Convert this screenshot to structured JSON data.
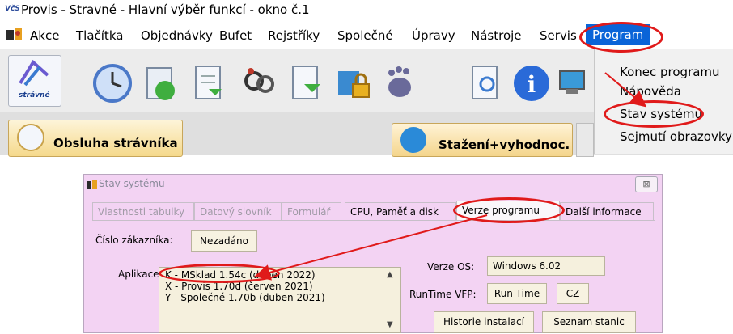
{
  "window": {
    "icon_text": "VčS",
    "title": "Provis - Stravné - Hlavní výběr funkcí - okno č.1"
  },
  "menubar": {
    "items": [
      "Akce",
      "Tlačítka",
      "Objednávky",
      "Bufet",
      "Rejstříky",
      "Společné",
      "Úpravy",
      "Nástroje",
      "Servis"
    ],
    "active_item": "Program"
  },
  "toolbar": {
    "logo_label": "strávné",
    "icons": [
      "clock-icon",
      "document-stack-icon",
      "document-icon",
      "keys-icon",
      "document-down-icon",
      "lock-icon",
      "footprint-icon",
      "search-document-icon",
      "info-icon",
      "computer-icon"
    ]
  },
  "program_menu": {
    "items": [
      "Konec programu",
      "Nápověda",
      "Stav systému",
      "Sejmutí obrazovky"
    ]
  },
  "buttons": {
    "obsluha": "Obsluha strávníka",
    "stazeni": "Stažení+vyhodnoc."
  },
  "dialog": {
    "title": "Stav systému",
    "close": "⊠",
    "tabs": [
      {
        "label": "Vlastnosti tabulky",
        "state": "disabled"
      },
      {
        "label": "Datový slovník",
        "state": "disabled"
      },
      {
        "label": "Formulář",
        "state": "disabled"
      },
      {
        "label": "CPU, Paměť a disk",
        "state": "enabled"
      },
      {
        "label": "Verze programu",
        "state": "active"
      },
      {
        "label": "Další informace",
        "state": "enabled"
      }
    ],
    "customer_label": "Číslo zákazníka:",
    "customer_value": "Nezadáno",
    "apps_label": "Aplikace",
    "apps": [
      "K - MSklad 1.54c (duben 2022)",
      "X - Provis 1.70d (červen 2021)",
      "Y - Společné 1.70b (duben 2021)"
    ],
    "os_label": "Verze OS:",
    "os_value": "Windows 6.02",
    "runtime_label": "RunTime VFP:",
    "runtime_value": "Run Time",
    "runtime_lang": "CZ",
    "history_button": "Historie instalací",
    "stations_button": "Seznam stanic"
  },
  "colors": {
    "annotation": "#e01a1a",
    "menu_highlight": "#0a64d8",
    "dialog_bg": "#f3d3f3"
  }
}
